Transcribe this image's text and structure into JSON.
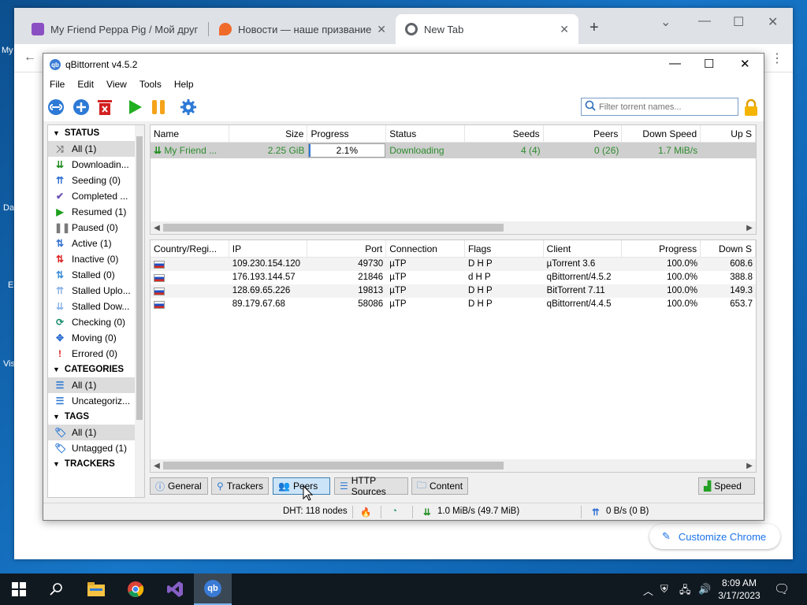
{
  "desktop": {
    "labels": [
      "My",
      "Da",
      "E",
      "Vis"
    ]
  },
  "chrome": {
    "tabs": [
      {
        "title": "My Friend Peppa Pig / Мой друг",
        "favicon_color": "#8b4fc4"
      },
      {
        "title": "Новости — наше призвание на",
        "favicon_color": "#f06a2a"
      },
      {
        "title": "New Tab",
        "favicon_color": "#5f6368"
      }
    ],
    "customize_label": "Customize Chrome"
  },
  "qb": {
    "title": "qBittorrent v4.5.2",
    "menu": [
      "File",
      "Edit",
      "View",
      "Tools",
      "Help"
    ],
    "search_placeholder": "Filter torrent names...",
    "sidebar": {
      "status_header": "STATUS",
      "status_items": [
        {
          "label": "All (1)",
          "icon": "shuffle-icon",
          "glyph": "⤨",
          "color": "#7a7a7a"
        },
        {
          "label": "Downloadin...",
          "icon": "download-icon",
          "glyph": "⇊",
          "color": "#1e8c1e"
        },
        {
          "label": "Seeding (0)",
          "icon": "seeding-icon",
          "glyph": "⇈",
          "color": "#2f6fd1"
        },
        {
          "label": "Completed ...",
          "icon": "check-icon",
          "glyph": "✔",
          "color": "#6a4fb8"
        },
        {
          "label": "Resumed (1)",
          "icon": "play-icon",
          "glyph": "▶",
          "color": "#1ea01e"
        },
        {
          "label": "Paused (0)",
          "icon": "pause-icon",
          "glyph": "❚❚",
          "color": "#7a7a7a"
        },
        {
          "label": "Active (1)",
          "icon": "active-icon",
          "glyph": "⇅",
          "color": "#2f6fd1"
        },
        {
          "label": "Inactive (0)",
          "icon": "inactive-icon",
          "glyph": "⇅",
          "color": "#d22"
        },
        {
          "label": "Stalled (0)",
          "icon": "stalled-icon",
          "glyph": "⇅",
          "color": "#3a8ed8"
        },
        {
          "label": "Stalled Uplo...",
          "icon": "stalled-upload-icon",
          "glyph": "⇈",
          "color": "#8ab4e8"
        },
        {
          "label": "Stalled Dow...",
          "icon": "stalled-download-icon",
          "glyph": "⇊",
          "color": "#8ab4e8"
        },
        {
          "label": "Checking (0)",
          "icon": "checking-icon",
          "glyph": "⟳",
          "color": "#1e8c6e"
        },
        {
          "label": "Moving (0)",
          "icon": "moving-icon",
          "glyph": "✥",
          "color": "#2f6fd1"
        },
        {
          "label": "Errored (0)",
          "icon": "error-icon",
          "glyph": "!",
          "color": "#d22"
        }
      ],
      "categories_header": "CATEGORIES",
      "category_items": [
        {
          "label": "All (1)",
          "icon": "list-icon"
        },
        {
          "label": "Uncategoriz...",
          "icon": "list-icon"
        }
      ],
      "tags_header": "TAGS",
      "tag_items": [
        {
          "label": "All (1)",
          "icon": "tag-icon"
        },
        {
          "label": "Untagged (1)",
          "icon": "tag-icon"
        }
      ],
      "trackers_header": "TRACKERS"
    },
    "torrent_table": {
      "columns": [
        "Name",
        "Size",
        "Progress",
        "Status",
        "Seeds",
        "Peers",
        "Down Speed",
        "Up S"
      ],
      "rows": [
        {
          "name": "My Friend ...",
          "size": "2.25 GiB",
          "progress": "2.1%",
          "progress_value": 0.021,
          "status": "Downloading",
          "seeds": "4 (4)",
          "peers": "0 (26)",
          "down_speed": "1.7 MiB/s",
          "up_speed": ""
        }
      ]
    },
    "peers_table": {
      "columns": [
        "Country/Regi...",
        "IP",
        "Port",
        "Connection",
        "Flags",
        "Client",
        "Progress",
        "Down S"
      ],
      "rows": [
        {
          "ip": "109.230.154.120",
          "port": "49730",
          "connection": "µTP",
          "flags": "D H P",
          "client": "µTorrent 3.6",
          "progress": "100.0%",
          "down": "608.6"
        },
        {
          "ip": "176.193.144.57",
          "port": "21846",
          "connection": "µTP",
          "flags": "d H P",
          "client": "qBittorrent/4.5.2",
          "progress": "100.0%",
          "down": "388.8"
        },
        {
          "ip": "128.69.65.226",
          "port": "19813",
          "connection": "µTP",
          "flags": "D H P",
          "client": "BitTorrent 7.11",
          "progress": "100.0%",
          "down": "149.3"
        },
        {
          "ip": "89.179.67.68",
          "port": "58086",
          "connection": "µTP",
          "flags": "D H P",
          "client": "qBittorrent/4.4.5",
          "progress": "100.0%",
          "down": "653.7"
        }
      ]
    },
    "bottom_tabs": {
      "general": "General",
      "trackers": "Trackers",
      "peers": "Peers",
      "http_sources": "HTTP Sources",
      "content": "Content",
      "speed": "Speed"
    },
    "status_bar": {
      "dht": "DHT: 118 nodes",
      "download": "1.0 MiB/s (49.7 MiB)",
      "upload": "0 B/s (0 B)"
    }
  },
  "taskbar": {
    "time": "8:09 AM",
    "date": "3/17/2023"
  }
}
